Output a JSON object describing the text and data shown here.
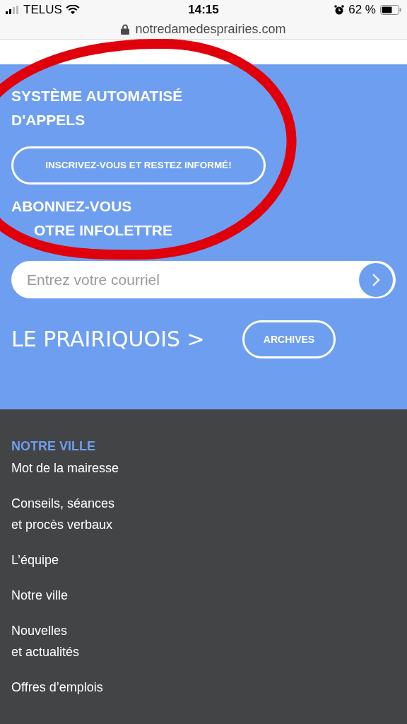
{
  "status_bar": {
    "carrier": "TELUS",
    "time": "14:15",
    "battery": "62 %"
  },
  "address_bar": {
    "url": "notredamedesprairies.com"
  },
  "alerts": {
    "title": "SYSTÈME AUTOMATISÉ D'APPELS",
    "button": "INSCRIVEZ-VOUS ET RESTEZ INFORMÉ!"
  },
  "newsletter": {
    "title_lines": [
      "ABONNEZ-VOUS",
      "OTRE INFOLETTRE"
    ],
    "email": {
      "placeholder": "Entrez votre courriel"
    },
    "brand": "LE PRAIRIQUOIS",
    "brand_arrow": ">",
    "archives_button": "ARCHIVES"
  },
  "footer": {
    "heading": "NOTRE VILLE",
    "links": [
      [
        "Mot de la mairesse"
      ],
      [
        "Conseils, séances",
        "et procès verbaux"
      ],
      [
        "L’équipe"
      ],
      [
        "Notre ville"
      ],
      [
        "Nouvelles",
        "et actualités"
      ],
      [
        "Offres d’emplois"
      ]
    ]
  }
}
